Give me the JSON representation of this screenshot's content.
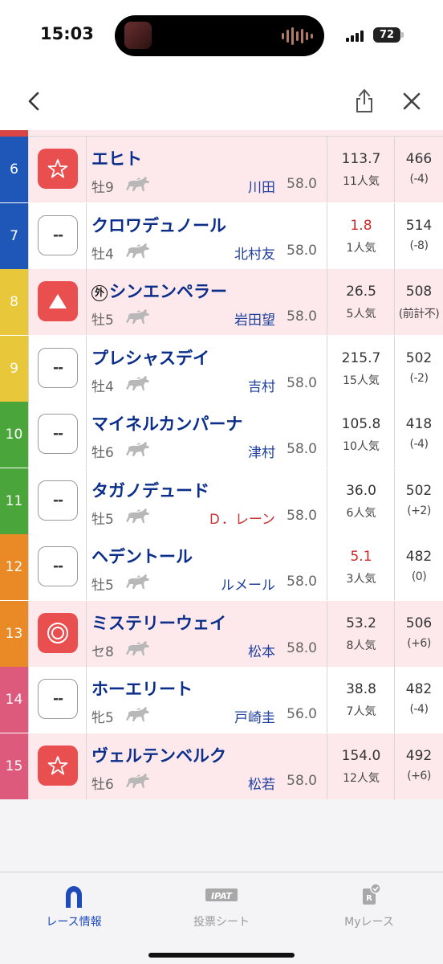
{
  "status": {
    "time": "15:03",
    "battery": "72"
  },
  "colors": {
    "frame_blue": "#1f57b8",
    "frame_yellow": "#e8c83a",
    "frame_green": "#4aa63a",
    "frame_orange": "#ea8a27",
    "frame_pink": "#de5a7c",
    "mark_red": "#ea4f4f",
    "name_blue": "#0b2e8a"
  },
  "horses": [
    {
      "num": "6",
      "frame_color": "#1f57b8",
      "mark": "☆",
      "mark_type": "star",
      "highlight": true,
      "foreign": "",
      "name": "エヒト",
      "sexage": "牡9",
      "jockey": "川田",
      "jockey_red": false,
      "kin": "58.0",
      "odds": "113.7",
      "odds_red": false,
      "pop": "11人気",
      "weight": "466",
      "diff": "(-4)"
    },
    {
      "num": "7",
      "frame_color": "#1f57b8",
      "mark": "--",
      "mark_type": "empty",
      "highlight": false,
      "foreign": "",
      "name": "クロワデュノール",
      "sexage": "牡4",
      "jockey": "北村友",
      "jockey_red": false,
      "kin": "58.0",
      "odds": "1.8",
      "odds_red": true,
      "pop": "1人気",
      "weight": "514",
      "diff": "(-8)"
    },
    {
      "num": "8",
      "frame_color": "#e8c83a",
      "mark": "▲",
      "mark_type": "triangle",
      "highlight": true,
      "foreign": "外",
      "name": "シンエンペラー",
      "sexage": "牡5",
      "jockey": "岩田望",
      "jockey_red": false,
      "kin": "58.0",
      "odds": "26.5",
      "odds_red": false,
      "pop": "5人気",
      "weight": "508",
      "diff": "(前計不)"
    },
    {
      "num": "9",
      "frame_color": "#e8c83a",
      "mark": "--",
      "mark_type": "empty",
      "highlight": false,
      "foreign": "",
      "name": "プレシャスデイ",
      "sexage": "牡4",
      "jockey": "吉村",
      "jockey_red": false,
      "kin": "58.0",
      "odds": "215.7",
      "odds_red": false,
      "pop": "15人気",
      "weight": "502",
      "diff": "(-2)"
    },
    {
      "num": "10",
      "frame_color": "#4aa63a",
      "mark": "--",
      "mark_type": "empty",
      "highlight": false,
      "foreign": "",
      "name": "マイネルカンパーナ",
      "sexage": "牡6",
      "jockey": "津村",
      "jockey_red": false,
      "kin": "58.0",
      "odds": "105.8",
      "odds_red": false,
      "pop": "10人気",
      "weight": "418",
      "diff": "(-4)"
    },
    {
      "num": "11",
      "frame_color": "#4aa63a",
      "mark": "--",
      "mark_type": "empty",
      "highlight": false,
      "foreign": "",
      "name": "タガノデュード",
      "sexage": "牡5",
      "jockey": "Ｄ．レーン",
      "jockey_red": true,
      "kin": "58.0",
      "odds": "36.0",
      "odds_red": false,
      "pop": "6人気",
      "weight": "502",
      "diff": "(+2)"
    },
    {
      "num": "12",
      "frame_color": "#ea8a27",
      "mark": "--",
      "mark_type": "empty",
      "highlight": false,
      "foreign": "",
      "name": "ヘデントール",
      "sexage": "牡5",
      "jockey": "ルメール",
      "jockey_red": false,
      "kin": "58.0",
      "odds": "5.1",
      "odds_red": true,
      "pop": "3人気",
      "weight": "482",
      "diff": "(0)"
    },
    {
      "num": "13",
      "frame_color": "#ea8a27",
      "mark": "◎",
      "mark_type": "double",
      "highlight": true,
      "foreign": "",
      "name": "ミステリーウェイ",
      "sexage": "セ8",
      "jockey": "松本",
      "jockey_red": false,
      "kin": "58.0",
      "odds": "53.2",
      "odds_red": false,
      "pop": "8人気",
      "weight": "506",
      "diff": "(+6)"
    },
    {
      "num": "14",
      "frame_color": "#de5a7c",
      "mark": "--",
      "mark_type": "empty",
      "highlight": false,
      "foreign": "",
      "name": "ホーエリート",
      "sexage": "牝5",
      "jockey": "戸崎圭",
      "jockey_red": false,
      "kin": "56.0",
      "odds": "38.8",
      "odds_red": false,
      "pop": "7人気",
      "weight": "482",
      "diff": "(-4)"
    },
    {
      "num": "15",
      "frame_color": "#de5a7c",
      "mark": "☆",
      "mark_type": "star",
      "highlight": true,
      "foreign": "",
      "name": "ヴェルテンベルク",
      "sexage": "牡6",
      "jockey": "松若",
      "jockey_red": false,
      "kin": "58.0",
      "odds": "154.0",
      "odds_red": false,
      "pop": "12人気",
      "weight": "492",
      "diff": "(+6)"
    }
  ],
  "tabs": [
    {
      "label": "レース情報",
      "icon": "horseshoe-icon",
      "active": true
    },
    {
      "label": "投票シート",
      "icon": "ipat-icon",
      "badge": "IPAT",
      "active": false
    },
    {
      "label": "Myレース",
      "icon": "my-race-icon",
      "badge": "R",
      "active": false
    }
  ]
}
